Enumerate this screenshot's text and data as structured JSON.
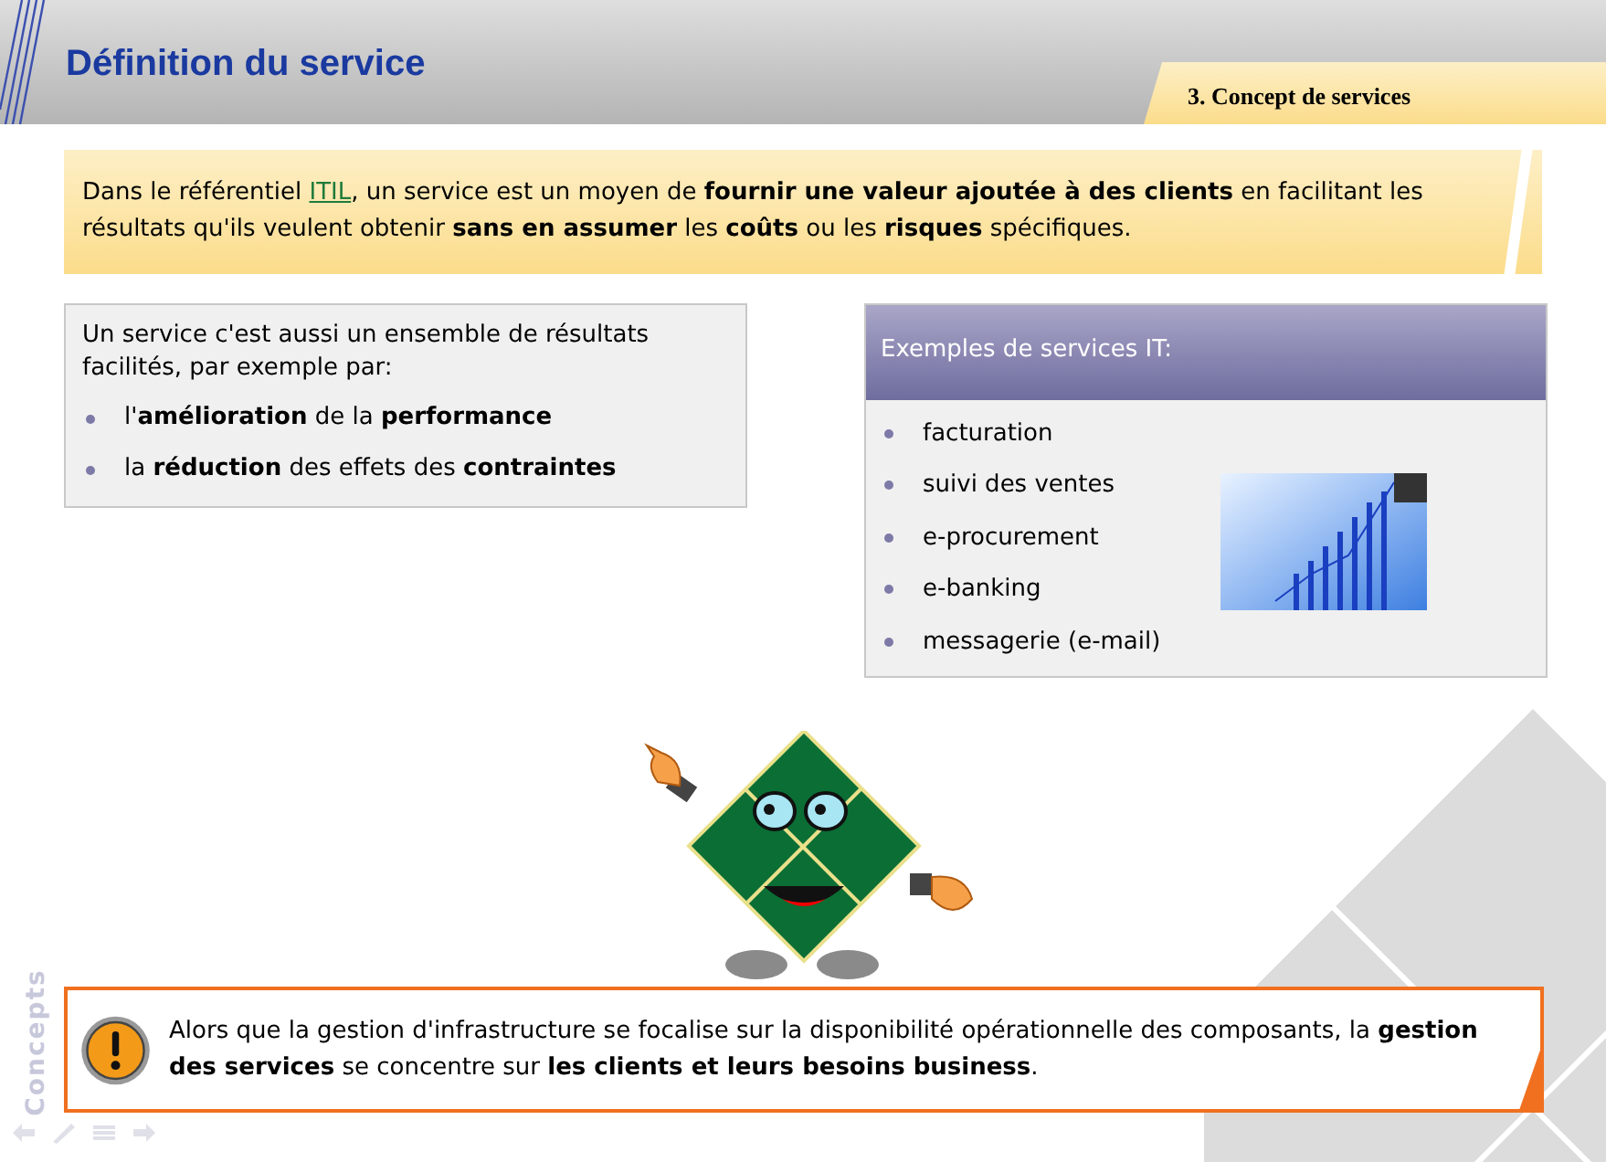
{
  "header": {
    "title": "Définition du service",
    "section_tab": "3. Concept de services"
  },
  "intro": {
    "before": "Dans le référentiel ",
    "link": "ITIL",
    "after": ", un service est un moyen de **fournir une valeur ajoutée à des clients** en facilitant les résultats qu'ils veulent obtenir **sans en assumer** les **coûts** ou les **risques** spécifiques."
  },
  "left_box": {
    "text": "Un service c'est aussi un ensemble de résultats facilités, par exemple par:",
    "bullets": [
      "l'**amélioration** de la **performance**",
      "la **réduction** des effets des **contraintes**"
    ]
  },
  "right_box": {
    "title": "Exemples de services IT:",
    "items": [
      "facturation",
      "suivi des ventes",
      "e-procurement",
      "e-banking",
      "messagerie (e-mail)"
    ]
  },
  "note": "Alors que la gestion d'infrastructure se focalise sur la disponibilité opérationnelle des composants, la **gestion des services** se concentre sur **les clients et leurs besoins business**.",
  "side_label": "Concepts"
}
